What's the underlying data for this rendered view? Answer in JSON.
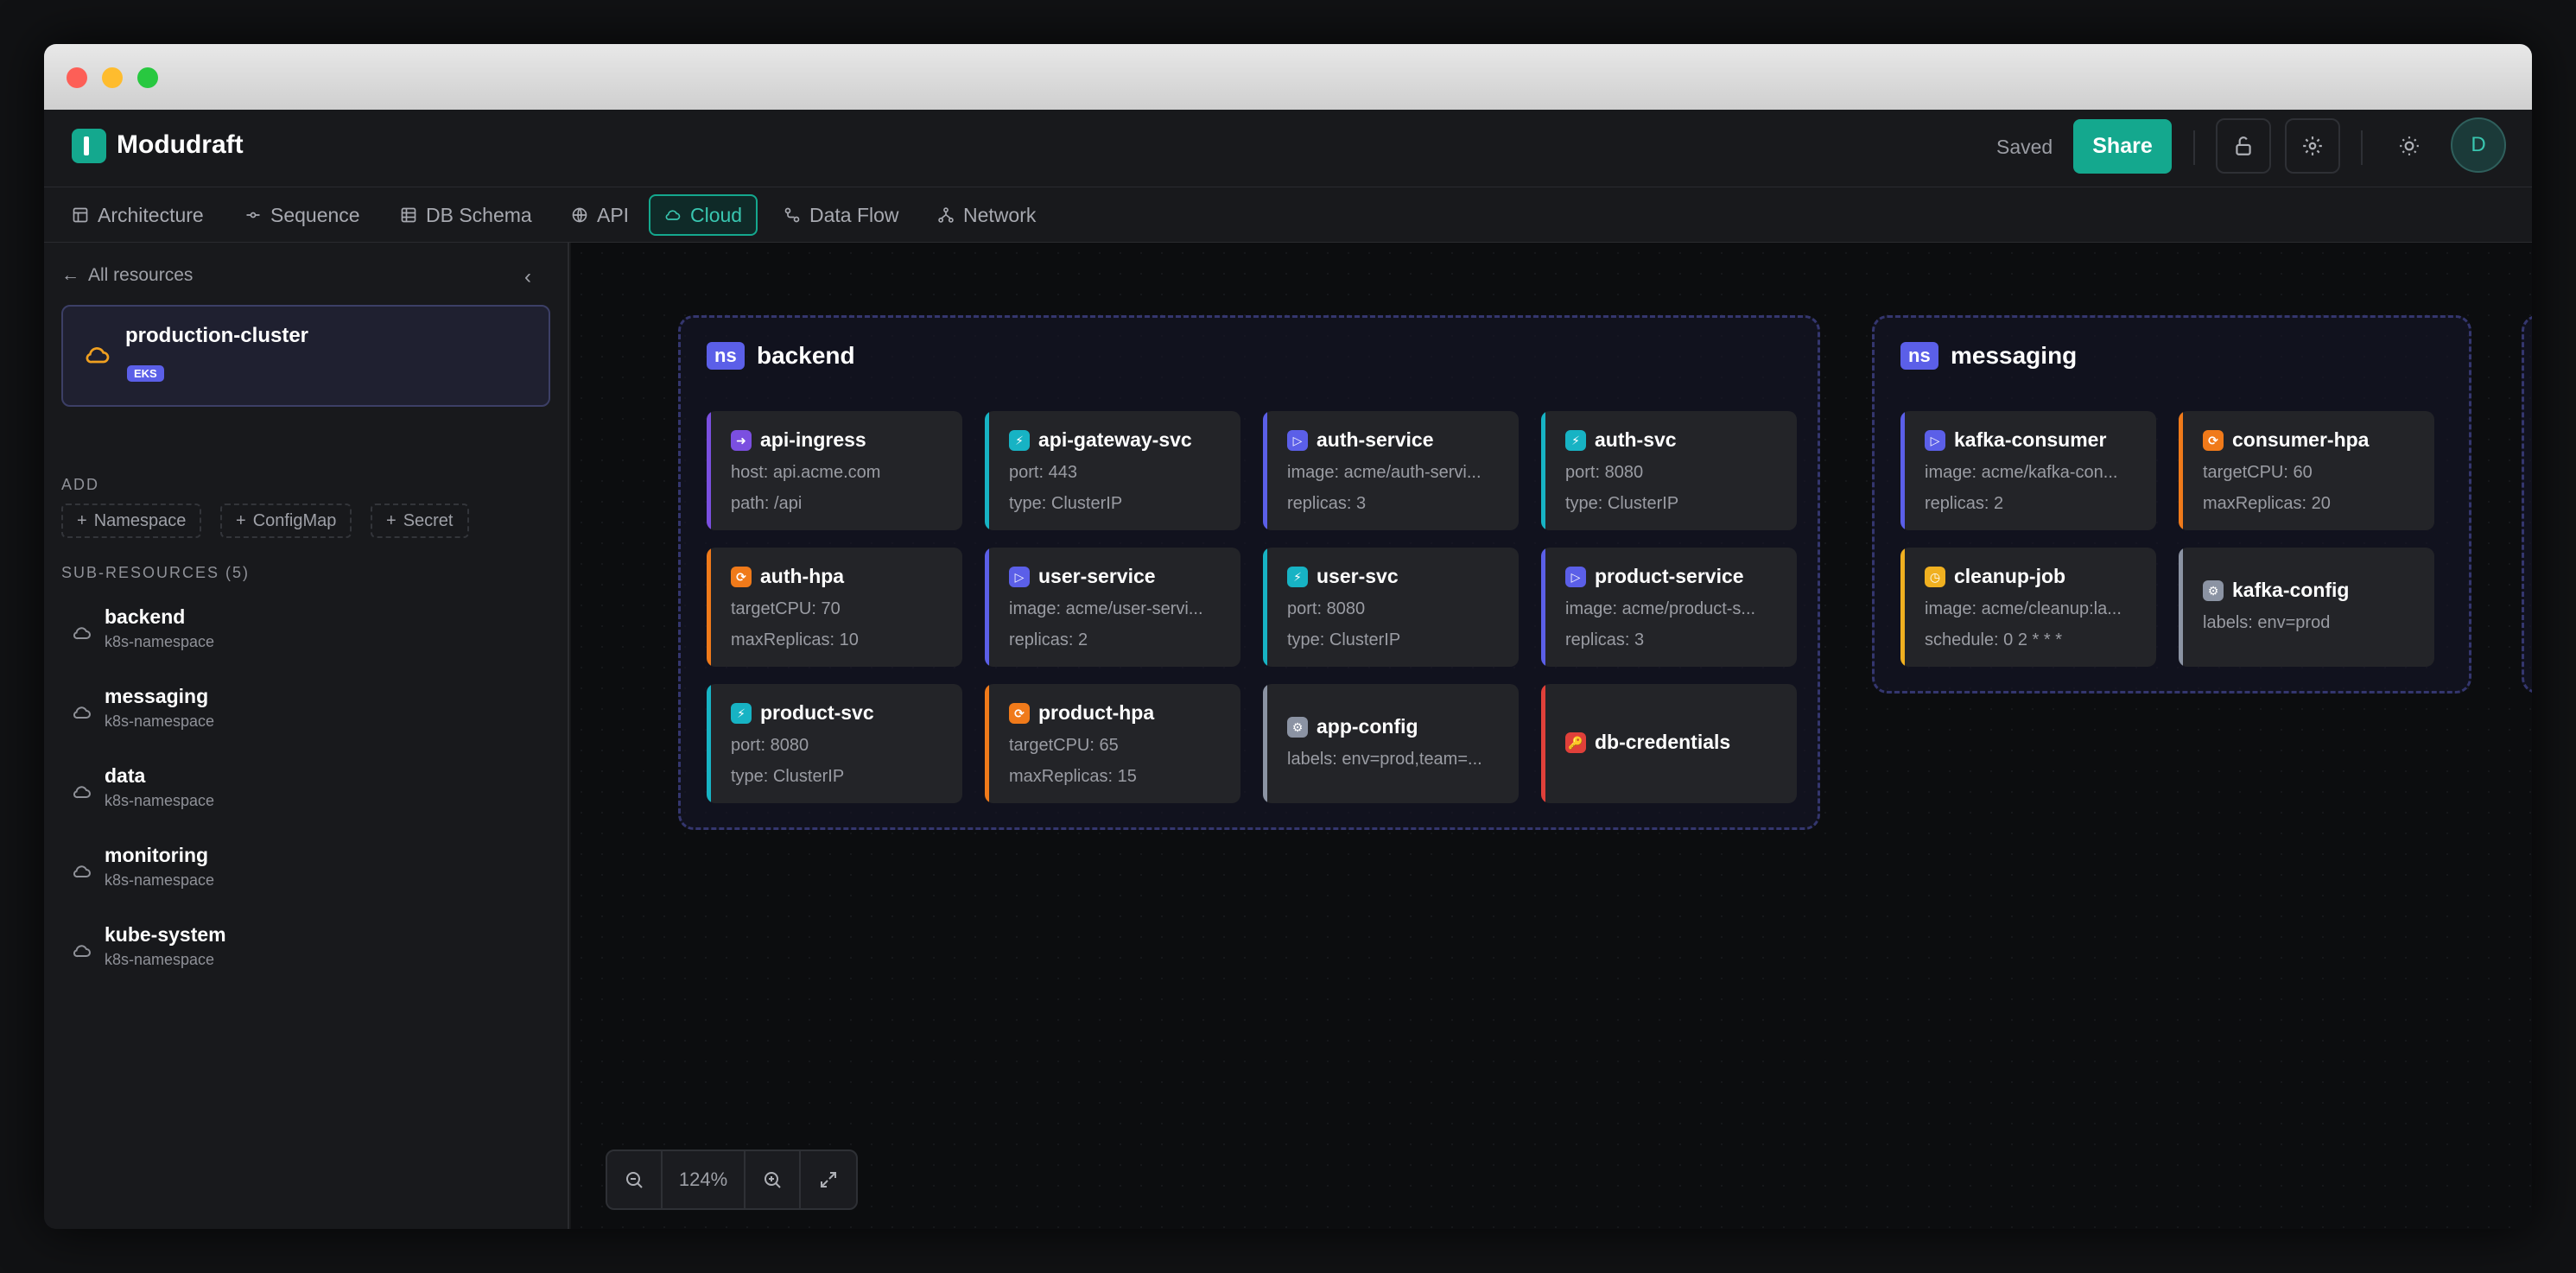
{
  "app": {
    "name": "Modudraft",
    "status": "Saved",
    "share_label": "Share",
    "avatar_initial": "D"
  },
  "tabs": [
    {
      "label": "Architecture",
      "icon": "layout-icon"
    },
    {
      "label": "Sequence",
      "icon": "commit-icon"
    },
    {
      "label": "DB Schema",
      "icon": "table-icon"
    },
    {
      "label": "API",
      "icon": "globe-icon"
    },
    {
      "label": "Cloud",
      "icon": "cloud-icon",
      "active": true
    },
    {
      "label": "Data Flow",
      "icon": "flow-icon"
    },
    {
      "label": "Network",
      "icon": "network-icon"
    }
  ],
  "sidebar": {
    "back_label": "All resources",
    "cluster": {
      "name": "production-cluster",
      "badge": "EKS"
    },
    "add_heading": "ADD",
    "add_buttons": [
      "Namespace",
      "ConfigMap",
      "Secret"
    ],
    "sub_heading": "SUB-RESOURCES (5)",
    "sub_resources": [
      {
        "name": "backend",
        "type": "k8s-namespace"
      },
      {
        "name": "messaging",
        "type": "k8s-namespace"
      },
      {
        "name": "data",
        "type": "k8s-namespace"
      },
      {
        "name": "monitoring",
        "type": "k8s-namespace"
      },
      {
        "name": "kube-system",
        "type": "k8s-namespace"
      }
    ]
  },
  "canvas": {
    "zoom": "124%",
    "namespaces": [
      {
        "badge": "ns",
        "name": "backend",
        "cards": [
          {
            "name": "api-ingress",
            "kind": "ingress",
            "color": "#7b4fe0",
            "glyph": "➜",
            "l1": "host: api.acme.com",
            "l2": "path: /api"
          },
          {
            "name": "api-gateway-svc",
            "kind": "service",
            "color": "#17b3c4",
            "glyph": "⚡",
            "l1": "port: 443",
            "l2": "type: ClusterIP"
          },
          {
            "name": "auth-service",
            "kind": "deployment",
            "color": "#5b5fe8",
            "glyph": "▷",
            "l1": "image: acme/auth-servi...",
            "l2": "replicas: 3"
          },
          {
            "name": "auth-svc",
            "kind": "service",
            "color": "#17b3c4",
            "glyph": "⚡",
            "l1": "port: 8080",
            "l2": "type: ClusterIP"
          },
          {
            "name": "auth-hpa",
            "kind": "hpa",
            "color": "#f07a1a",
            "glyph": "⟳",
            "l1": "targetCPU: 70",
            "l2": "maxReplicas: 10"
          },
          {
            "name": "user-service",
            "kind": "deployment",
            "color": "#5b5fe8",
            "glyph": "▷",
            "l1": "image: acme/user-servi...",
            "l2": "replicas: 2"
          },
          {
            "name": "user-svc",
            "kind": "service",
            "color": "#17b3c4",
            "glyph": "⚡",
            "l1": "port: 8080",
            "l2": "type: ClusterIP"
          },
          {
            "name": "product-service",
            "kind": "deployment",
            "color": "#5b5fe8",
            "glyph": "▷",
            "l1": "image: acme/product-s...",
            "l2": "replicas: 3"
          },
          {
            "name": "product-svc",
            "kind": "service",
            "color": "#17b3c4",
            "glyph": "⚡",
            "l1": "port: 8080",
            "l2": "type: ClusterIP"
          },
          {
            "name": "product-hpa",
            "kind": "hpa",
            "color": "#f07a1a",
            "glyph": "⟳",
            "l1": "targetCPU: 65",
            "l2": "maxReplicas: 15"
          },
          {
            "name": "app-config",
            "kind": "configmap",
            "color": "#8b93a3",
            "glyph": "⚙",
            "l1": "labels: env=prod,team=...",
            "l2": ""
          },
          {
            "name": "db-credentials",
            "kind": "secret",
            "color": "#e0403a",
            "glyph": "🔑",
            "l1": "",
            "l2": ""
          }
        ]
      },
      {
        "badge": "ns",
        "name": "messaging",
        "cards": [
          {
            "name": "kafka-consumer",
            "kind": "deployment",
            "color": "#5b5fe8",
            "glyph": "▷",
            "l1": "image: acme/kafka-con...",
            "l2": "replicas: 2"
          },
          {
            "name": "consumer-hpa",
            "kind": "hpa",
            "color": "#f07a1a",
            "glyph": "⟳",
            "l1": "targetCPU: 60",
            "l2": "maxReplicas: 20"
          },
          {
            "name": "cleanup-job",
            "kind": "cronjob",
            "color": "#f0b020",
            "glyph": "◷",
            "l1": "image: acme/cleanup:la...",
            "l2": "schedule: 0 2 * * *"
          },
          {
            "name": "kafka-config",
            "kind": "configmap",
            "color": "#8b93a3",
            "glyph": "⚙",
            "l1": "labels: env=prod",
            "l2": ""
          }
        ]
      }
    ]
  }
}
